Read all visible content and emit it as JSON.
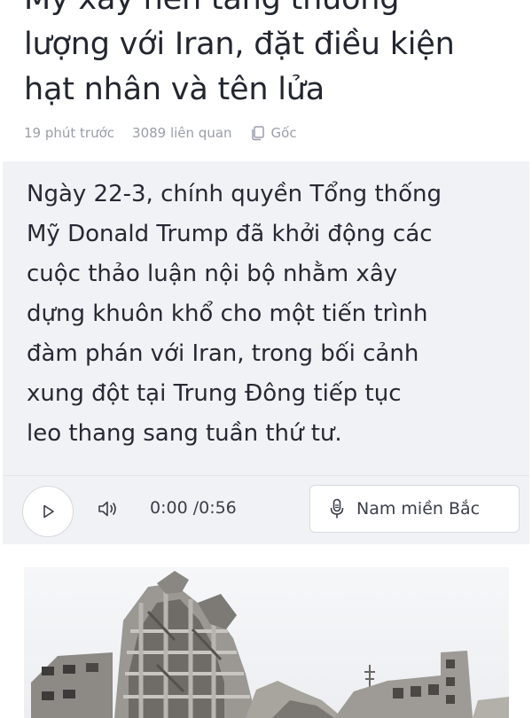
{
  "article": {
    "headline_lines": [
      "Mỹ xây nền tảng thương",
      "lượng với Iran, đặt điều kiện",
      "hạt nhân và tên lửa"
    ],
    "meta": {
      "time_ago": "19 phút trước",
      "related": "3089 liên quan",
      "source_label": "Gốc"
    },
    "summary_lines": [
      "Ngày 22-3, chính quyền Tổng thống",
      "Mỹ Donald Trump đã khởi động các",
      "cuộc thảo luận nội bộ nhằm xây",
      "dựng khuôn khổ cho một tiến trình",
      "đàm phán với Iran, trong bối cảnh",
      "xung đột tại Trung Đông tiếp tục",
      "leo thang sang tuần thứ tư."
    ]
  },
  "audio_player": {
    "play_icon": "play-icon",
    "volume_icon": "volume-icon",
    "time": "0:00 /0:56",
    "voice_icon": "microphone-icon",
    "voice_label": "Nam miền Bắc"
  },
  "image": {
    "subject": "destroyed-buildings-photo"
  },
  "colors": {
    "summary_background": "#f1f2f6",
    "meta_text": "#9a9ea8",
    "headline_text": "#23262f"
  }
}
